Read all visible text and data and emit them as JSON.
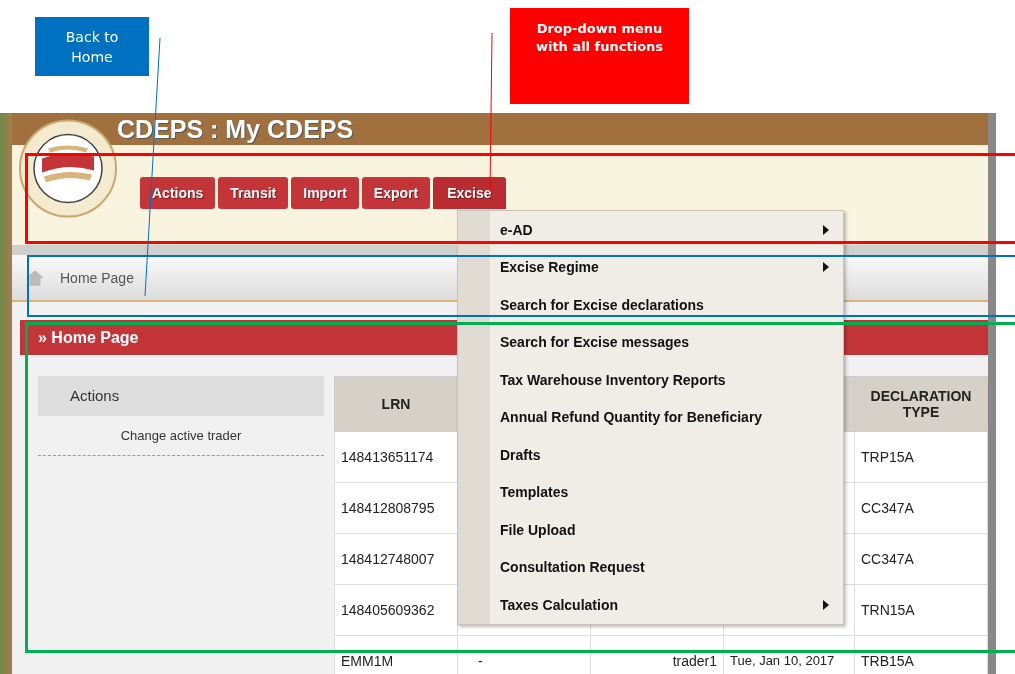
{
  "callouts": [
    {
      "text": "Back to Home",
      "color": "#0070c0",
      "kind": "blue"
    },
    {
      "text": "Drop-down menu with all functions",
      "color": "#ff0000",
      "kind": "red"
    }
  ],
  "highlight_frames": [
    {
      "color": "#ff0000",
      "kind": "nav"
    },
    {
      "color": "#0070c0",
      "kind": "breadcrumb"
    },
    {
      "color": "#00b050",
      "kind": "content"
    }
  ],
  "window": {
    "title": "CDEPS : My CDEPS"
  },
  "nav": [
    {
      "label": "Actions",
      "selected": false
    },
    {
      "label": "Transit",
      "selected": false
    },
    {
      "label": "Import",
      "selected": false
    },
    {
      "label": "Export",
      "selected": false
    },
    {
      "label": "Excise",
      "selected": true
    }
  ],
  "breadcrumb": [
    "Home Page"
  ],
  "section_title": "» Home Page",
  "sidebar": {
    "title": "Actions",
    "items": [
      "Change active trader"
    ]
  },
  "table": {
    "header": {
      "column_1": "LRN",
      "column_5": "DECLARATION TYPE"
    },
    "rows": [
      {
        "column_1": "148413651174",
        "column_5": "TRP15A"
      },
      {
        "column_1": "148412808795",
        "column_5": "CC347A"
      },
      {
        "column_1": "148412748007",
        "column_5": "CC347A"
      },
      {
        "column_1": "148405609362",
        "column_5": "TRN15A"
      },
      {
        "column_1": "EMM1M",
        "column_2": "-",
        "column_3": "trader1",
        "column_4": "Tue, Jan 10, 2017",
        "column_5": "TRB15A"
      }
    ]
  },
  "dropdown_menu": [
    {
      "label": "e-AD",
      "submenu": true
    },
    {
      "label": "Excise Regime",
      "submenu": true
    },
    {
      "label": "Search for Excise declarations",
      "submenu": false
    },
    {
      "label": "Search for Excise messages",
      "submenu": false
    },
    {
      "label": "Tax Warehouse Inventory Reports",
      "submenu": false
    },
    {
      "label": "Annual Refund Quantity for Beneficiary",
      "submenu": false
    },
    {
      "label": "Drafts",
      "submenu": false
    },
    {
      "label": "Templates",
      "submenu": false
    },
    {
      "label": "File Upload",
      "submenu": false
    },
    {
      "label": "Consultation Request",
      "submenu": false
    },
    {
      "label": "Taxes Calculation",
      "submenu": true
    }
  ]
}
